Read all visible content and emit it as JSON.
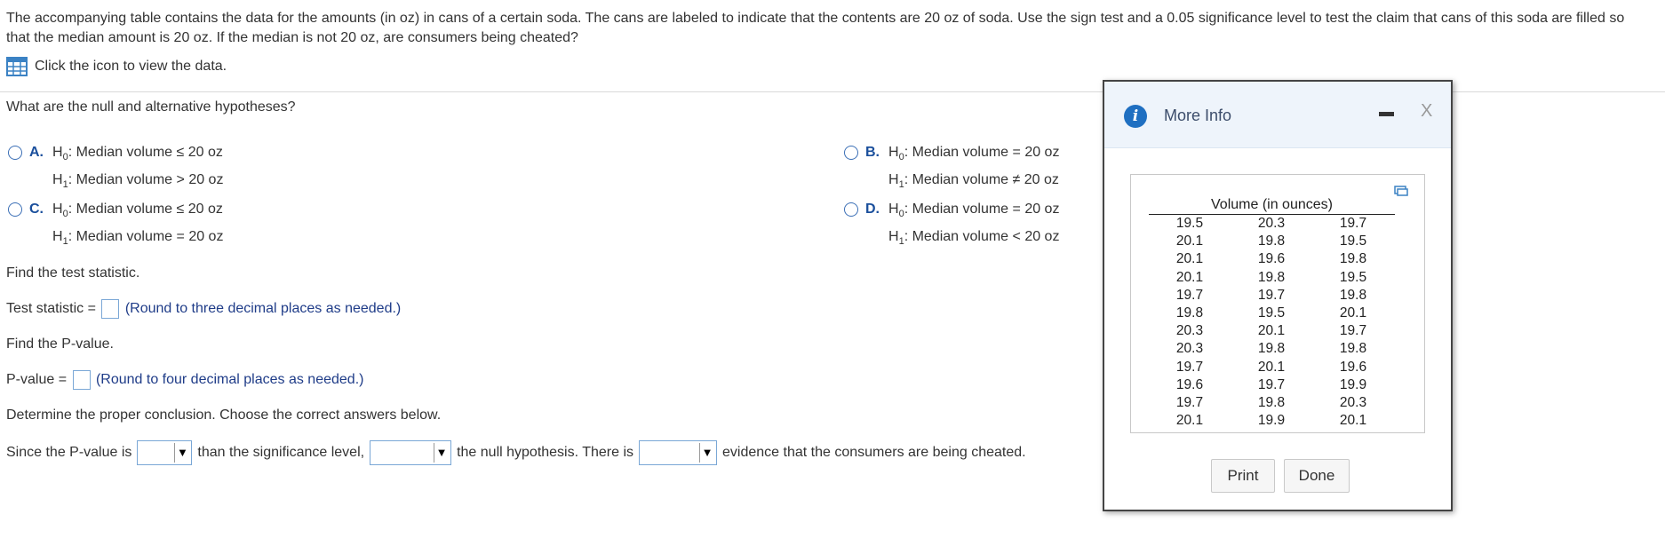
{
  "intro": {
    "line1": "The accompanying table contains the data for the amounts (in oz) in cans of a certain soda. The cans are labeled to indicate that the contents are 20 oz of soda. Use the sign test and a 0.05 significance level to test the claim that cans of this soda are filled so",
    "line2": "that the median amount is 20 oz. If the median is not 20 oz, are consumers being cheated?"
  },
  "view_data": {
    "label": "Click the icon to view the data.",
    "icon": "table-grid-icon"
  },
  "hypotheses": {
    "question": "What are the null and alternative hypotheses?",
    "options": [
      {
        "letter": "A.",
        "h0": "Median volume ≤ 20 oz",
        "h1": "Median volume > 20 oz"
      },
      {
        "letter": "B.",
        "h0": "Median volume = 20 oz",
        "h1": "Median volume ≠ 20 oz"
      },
      {
        "letter": "C.",
        "h0": "Median volume ≤ 20 oz",
        "h1": "Median volume = 20 oz"
      },
      {
        "letter": "D.",
        "h0": "Median volume = 20 oz",
        "h1": "Median volume < 20 oz"
      }
    ],
    "h0_prefix": "H",
    "h0_sub": "0",
    "h1_prefix": "H",
    "h1_sub": "1"
  },
  "test_stat": {
    "heading": "Find the test statistic.",
    "label": "Test statistic =",
    "hint": "(Round to three decimal places as needed.)"
  },
  "pvalue": {
    "heading": "Find the P-value.",
    "label": "P-value =",
    "hint": "(Round to four decimal places as needed.)"
  },
  "conclusion": {
    "heading": "Determine the proper conclusion. Choose the correct answers below.",
    "part1": "Since the P-value is",
    "part2": "than the significance level,",
    "part3": "the null hypothesis. There is",
    "part4": "evidence that the consumers are being cheated.",
    "dropdown_arrow": "▼"
  },
  "popup": {
    "title": "More Info",
    "close": "X",
    "table_header": "Volume (in ounces)",
    "rows": [
      [
        "19.5",
        "20.3",
        "19.7"
      ],
      [
        "20.1",
        "19.8",
        "19.5"
      ],
      [
        "20.1",
        "19.6",
        "19.8"
      ],
      [
        "20.1",
        "19.8",
        "19.5"
      ],
      [
        "19.7",
        "19.7",
        "19.8"
      ],
      [
        "19.8",
        "19.5",
        "20.1"
      ],
      [
        "20.3",
        "20.1",
        "19.7"
      ],
      [
        "20.3",
        "19.8",
        "19.8"
      ],
      [
        "19.7",
        "20.1",
        "19.6"
      ],
      [
        "19.6",
        "19.7",
        "19.9"
      ],
      [
        "19.7",
        "19.8",
        "20.3"
      ],
      [
        "20.1",
        "19.9",
        "20.1"
      ]
    ],
    "print_label": "Print",
    "done_label": "Done"
  },
  "colors": {
    "accent": "#1f6fc1",
    "option_letter": "#1a4f9c",
    "hint": "#1f3c88"
  }
}
